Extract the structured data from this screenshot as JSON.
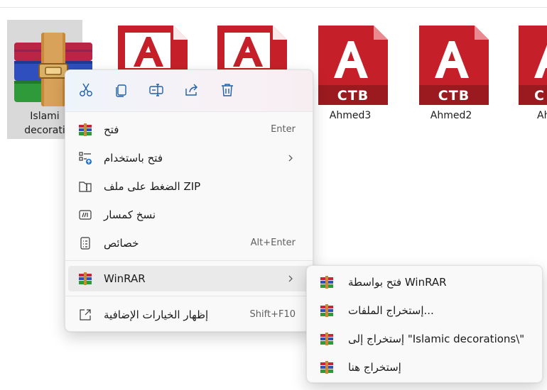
{
  "files": [
    {
      "id": "winrar-file",
      "label_line1": "Islami",
      "label_line2": "decorati"
    },
    {
      "id": "acad-1",
      "label": "",
      "badge": ""
    },
    {
      "id": "acad-2",
      "label": "",
      "badge": ""
    },
    {
      "id": "acad-3",
      "label": "Ahmed3",
      "badge": "CTB"
    },
    {
      "id": "acad-4",
      "label": "Ahmed2",
      "badge": "CTB"
    },
    {
      "id": "acad-5",
      "label": "Ah",
      "badge": "C"
    }
  ],
  "quick_actions": [
    {
      "name": "cut-icon"
    },
    {
      "name": "copy-icon"
    },
    {
      "name": "rename-icon"
    },
    {
      "name": "share-icon"
    },
    {
      "name": "delete-icon"
    }
  ],
  "menu": {
    "items": [
      {
        "label": "فتح",
        "shortcut": "Enter",
        "icon": "winrar-icon"
      },
      {
        "label": "فتح باستخدام",
        "shortcut": "",
        "icon": "open-with-icon",
        "submenu": true
      },
      {
        "label": "الضغط على ملف ZIP",
        "shortcut": "",
        "icon": "zip-icon"
      },
      {
        "label": "نسخ كمسار",
        "shortcut": "",
        "icon": "copy-path-icon"
      },
      {
        "label": "خصائص",
        "shortcut": "Alt+Enter",
        "icon": "properties-icon"
      },
      {
        "label": "WinRAR",
        "shortcut": "",
        "icon": "winrar-icon",
        "submenu": true,
        "highlighted": true
      },
      {
        "label": "إظهار الخيارات الإضافية",
        "shortcut": "Shift+F10",
        "icon": "more-options-icon"
      }
    ]
  },
  "submenu": {
    "items": [
      {
        "label": "فتح بواسطة WinRAR"
      },
      {
        "label": "إستخراج الملفات..."
      },
      {
        "label": "إستخراج إلى \"Islamic decorations\\\""
      },
      {
        "label": "إستخراج هنا"
      }
    ]
  }
}
